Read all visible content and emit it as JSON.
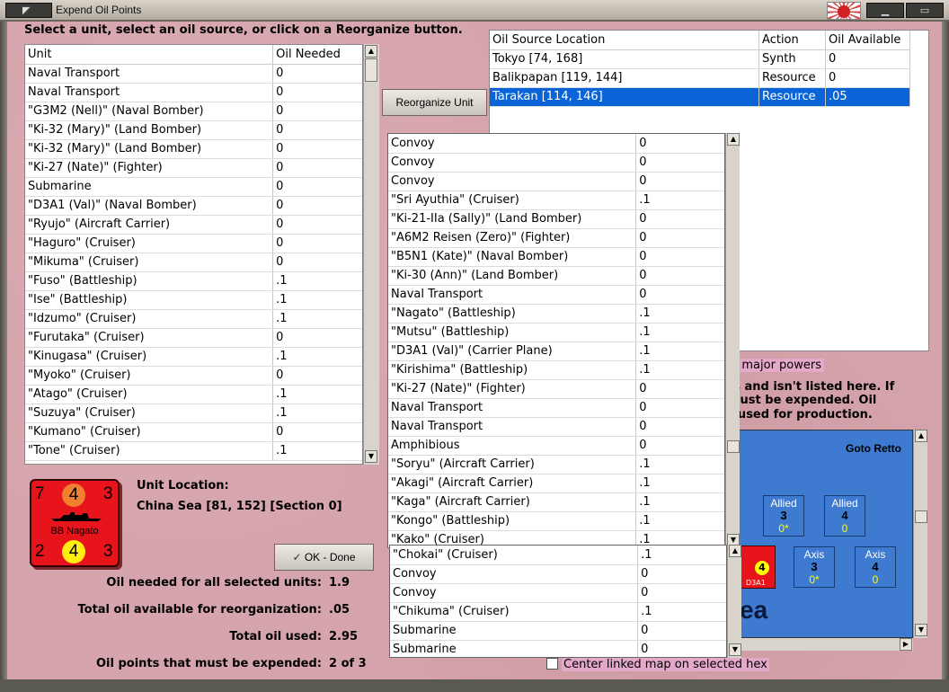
{
  "window": {
    "title": "Expend Oil Points",
    "flag_icon": "rising-sun-flag-icon"
  },
  "instruction": "Select a unit, select an oil source, or click on a Reorganize button.",
  "units_table": {
    "headers": [
      "Unit",
      "Oil Needed"
    ],
    "rows": [
      [
        "Naval Transport",
        "0"
      ],
      [
        "Naval Transport",
        "0"
      ],
      [
        "\"G3M2 (Nell)\" (Naval Bomber)",
        "0"
      ],
      [
        "\"Ki-32 (Mary)\" (Land Bomber)",
        "0"
      ],
      [
        "\"Ki-32 (Mary)\" (Land Bomber)",
        "0"
      ],
      [
        "\"Ki-27 (Nate)\" (Fighter)",
        "0"
      ],
      [
        "Submarine",
        "0"
      ],
      [
        "\"D3A1 (Val)\" (Naval Bomber)",
        "0"
      ],
      [
        "\"Ryujo\" (Aircraft Carrier)",
        "0"
      ],
      [
        "\"Haguro\" (Cruiser)",
        "0"
      ],
      [
        "\"Mikuma\" (Cruiser)",
        "0"
      ],
      [
        "\"Fuso\" (Battleship)",
        ".1"
      ],
      [
        "\"Ise\" (Battleship)",
        ".1"
      ],
      [
        "\"Idzumo\" (Cruiser)",
        ".1"
      ],
      [
        "\"Furutaka\" (Cruiser)",
        "0"
      ],
      [
        "\"Kinugasa\" (Cruiser)",
        ".1"
      ],
      [
        "\"Myoko\" (Cruiser)",
        "0"
      ],
      [
        "\"Atago\" (Cruiser)",
        ".1"
      ],
      [
        "\"Suzuya\" (Cruiser)",
        ".1"
      ],
      [
        "\"Kumano\" (Cruiser)",
        "0"
      ],
      [
        "\"Tone\" (Cruiser)",
        ".1"
      ]
    ]
  },
  "oil_sources": {
    "headers": [
      "Oil Source Location",
      "Action",
      "Oil Available"
    ],
    "rows": [
      [
        "Tokyo [74, 168]",
        "Synth",
        "0"
      ],
      [
        "Balikpapan [119, 144]",
        "Resource",
        "0"
      ],
      [
        "Tarakan [114, 146]",
        "Resource",
        ".05"
      ]
    ],
    "selected_index": 2
  },
  "reorganize_button": "Reorganize Unit",
  "dropdown_list": {
    "rows": [
      [
        "Convoy",
        "0"
      ],
      [
        "Convoy",
        "0"
      ],
      [
        "Convoy",
        "0"
      ],
      [
        "\"Sri Ayuthia\" (Cruiser)",
        ".1"
      ],
      [
        "\"Ki-21-IIa (Sally)\" (Land Bomber)",
        "0"
      ],
      [
        "\"A6M2 Reisen (Zero)\" (Fighter)",
        "0"
      ],
      [
        "\"B5N1 (Kate)\" (Naval Bomber)",
        "0"
      ],
      [
        "\"Ki-30 (Ann)\" (Land Bomber)",
        "0"
      ],
      [
        "Naval Transport",
        "0"
      ],
      [
        "\"Nagato\" (Battleship)",
        ".1"
      ],
      [
        "\"Mutsu\" (Battleship)",
        ".1"
      ],
      [
        "\"D3A1 (Val)\" (Carrier Plane)",
        ".1"
      ],
      [
        "\"Kirishima\" (Battleship)",
        ".1"
      ],
      [
        "\"Ki-27 (Nate)\" (Fighter)",
        "0"
      ],
      [
        "Naval Transport",
        "0"
      ],
      [
        "Naval Transport",
        "0"
      ],
      [
        "Amphibious",
        "0"
      ],
      [
        "\"Soryu\" (Aircraft Carrier)",
        ".1"
      ],
      [
        "\"Akagi\" (Aircraft Carrier)",
        ".1"
      ],
      [
        "\"Kaga\" (Aircraft Carrier)",
        ".1"
      ],
      [
        "\"Kongo\" (Battleship)",
        ".1"
      ],
      [
        "\"Kako\" (Cruiser)",
        ".1"
      ]
    ]
  },
  "dropdown_list2": {
    "rows": [
      [
        "\"Chokai\" (Cruiser)",
        ".1"
      ],
      [
        "Convoy",
        "0"
      ],
      [
        "Convoy",
        "0"
      ],
      [
        "\"Chikuma\" (Cruiser)",
        ".1"
      ],
      [
        "Submarine",
        "0"
      ],
      [
        "Submarine",
        "0"
      ]
    ]
  },
  "info_text": {
    "line0": "g major powers",
    "line1": "ts and isn't listed here.  If",
    "line2": "must be expended.   Oil",
    "line3": "r used for production."
  },
  "unit_location": {
    "label": "Unit Location:",
    "value": "China Sea [81, 152] [Section 0]"
  },
  "counter": {
    "tl": "7",
    "tc": "4",
    "tr": "3",
    "name": "BB Nagato",
    "bl": "2",
    "bc": "4",
    "br": "3",
    "ship_icon": "battleship-silhouette-icon"
  },
  "ok_button": "OK - Done",
  "summary": [
    {
      "label": "Oil needed for all selected units:",
      "value": "1.9"
    },
    {
      "label": "Total oil available for reorganization:",
      "value": ".05"
    },
    {
      "label": "Total oil used:",
      "value": "2.95"
    },
    {
      "label": "Oil points that must be expended:",
      "value": "2 of 3"
    }
  ],
  "map": {
    "place": "Goto Retto",
    "sea_label": "ea",
    "boxes": [
      {
        "side": "Allied",
        "num": "3",
        "sub": "0*"
      },
      {
        "side": "Allied",
        "num": "4",
        "sub": "0"
      },
      {
        "side": "Axis",
        "num": "3",
        "sub": "0*"
      },
      {
        "side": "Axis",
        "num": "4",
        "sub": "0"
      }
    ],
    "unit_chip": {
      "label": "D3A1",
      "value": "4",
      "badge": "4"
    }
  },
  "center_checkbox": {
    "label": "Center linked map on selected hex",
    "checked": false
  },
  "colors": {
    "selection": "#0a64d8",
    "background": "#d6a4ac",
    "counter_red": "#e8141c",
    "map_sea": "#3d7ad0"
  }
}
